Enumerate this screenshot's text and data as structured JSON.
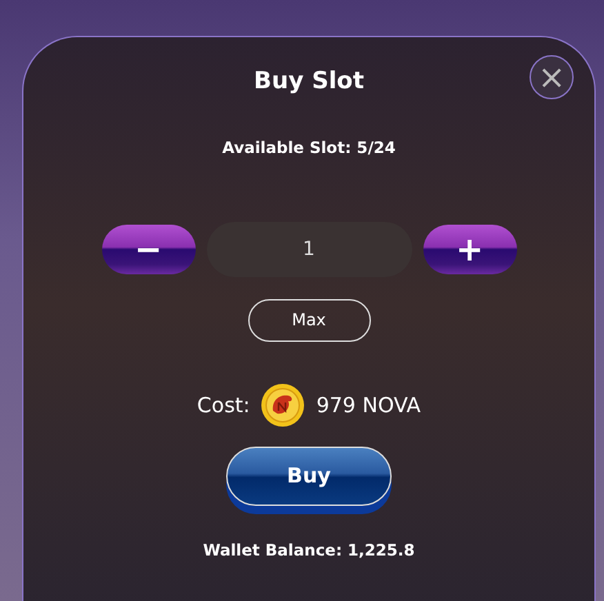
{
  "dialog": {
    "title": "Buy Slot",
    "close_label": "×",
    "available": "Available Slot: 5/24"
  },
  "stepper": {
    "decrement": "−",
    "value": "1",
    "increment": "+"
  },
  "max_button": "Max",
  "cost": {
    "label": "Cost:",
    "amount": "979 NOVA"
  },
  "buy_button": "Buy",
  "wallet": "Wallet Balance: 1,225.8"
}
